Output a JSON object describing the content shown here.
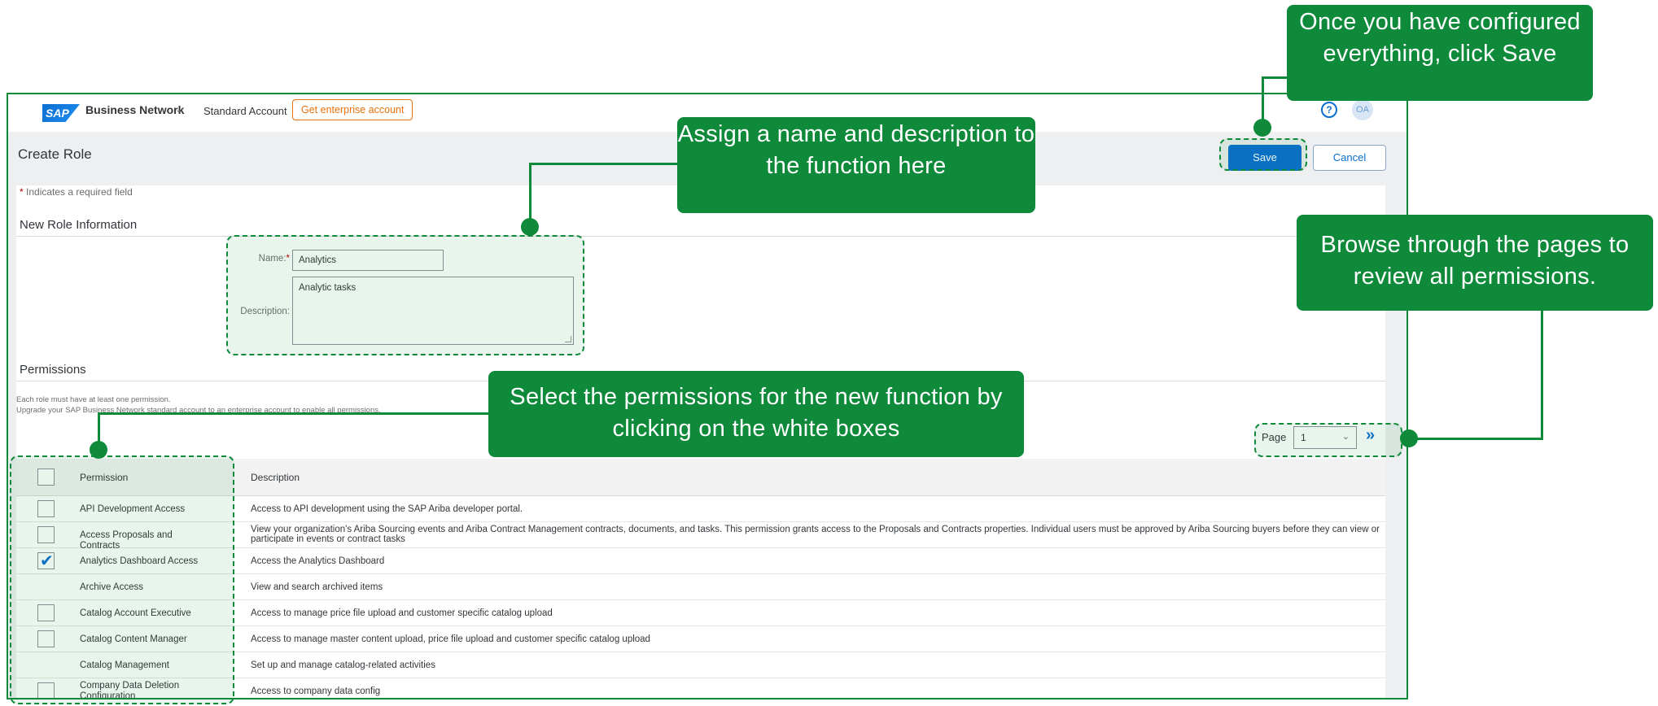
{
  "shellbar": {
    "logo_text": "SAP",
    "product_name": "Business Network",
    "product_caret": "⌄",
    "account_type": "Standard Account",
    "enterprise_button": "Get enterprise account",
    "help_icon": "?",
    "avatar_initials": "OA"
  },
  "header": {
    "title": "Create Role",
    "save_label": "Save",
    "cancel_label": "Cancel"
  },
  "form": {
    "required_star": "*",
    "required_note": " Indicates a required field",
    "section_title": "New Role Information",
    "name_label": "Name:",
    "name_star": "*",
    "name_value": "Analytics",
    "description_label": "Description:",
    "description_value": "Analytic tasks"
  },
  "permissions": {
    "section_title": "Permissions",
    "note_line1": "Each role must have at least one permission.",
    "note_line2": "Upgrade your SAP Business Network standard account to an enterprise account to enable all permissions.",
    "page_label": "Page",
    "page_value": "1",
    "page_caret": "⌄",
    "next_icon": "»",
    "columns": [
      "Permission",
      "Description"
    ],
    "rows": [
      {
        "permission": "API Development Access",
        "description": "Access to API development using the SAP Ariba developer portal.",
        "checkbox": true,
        "checked": false
      },
      {
        "permission": "Access Proposals and Contracts",
        "description": "View your organization's Ariba Sourcing events and Ariba Contract Management contracts, documents, and tasks. This permission grants access to the Proposals and Contracts properties. Individual users must be approved by Ariba Sourcing buyers before they can view or participate in events or contract tasks",
        "checkbox": true,
        "checked": false
      },
      {
        "permission": "Analytics Dashboard Access",
        "description": "Access the Analytics Dashboard",
        "checkbox": true,
        "checked": true
      },
      {
        "permission": "Archive Access",
        "description": "View and search archived items",
        "checkbox": false,
        "checked": false
      },
      {
        "permission": "Catalog Account Executive",
        "description": "Access to manage price file upload and customer specific catalog upload",
        "checkbox": true,
        "checked": false
      },
      {
        "permission": "Catalog Content Manager",
        "description": "Access to manage master content upload, price file upload and customer specific catalog upload",
        "checkbox": true,
        "checked": false
      },
      {
        "permission": "Catalog Management",
        "description": "Set up and manage catalog-related activities",
        "checkbox": false,
        "checked": false
      },
      {
        "permission": "Company Data Deletion Configuration",
        "description": "Access to company data config",
        "checkbox": true,
        "checked": false
      }
    ]
  },
  "callouts": {
    "save": "Once you have configured everything, click Save",
    "name": "Assign a name and description to the function here",
    "pages": "Browse through the pages to review all permissions.",
    "select": "Select the permissions for the new function by clicking on the white boxes"
  },
  "colors": {
    "callout_green": "#0e8a3a",
    "sap_blue": "#0a6ed1",
    "enterprise_orange": "#e9730c"
  }
}
